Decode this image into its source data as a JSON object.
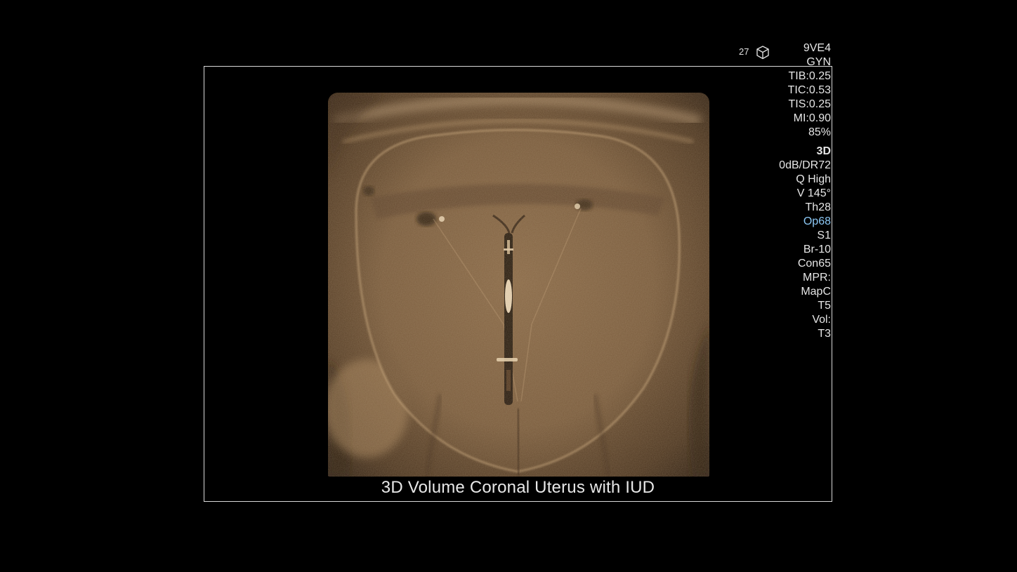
{
  "viewer": {
    "frame_counter": "27",
    "cube_icon": "3d-cube-icon",
    "caption": "3D Volume Coronal Uterus with IUD"
  },
  "params": {
    "probe": "9VE4",
    "preset": "GYN",
    "tib": "TIB:0.25",
    "tic": "TIC:0.53",
    "tis": "TIS:0.25",
    "mi": "MI:0.90",
    "power": "85%",
    "mode": "3D",
    "gain_dr": "0dB/DR72",
    "quality": "Q High",
    "volume_angle": "V 145°",
    "threshold": "Th28",
    "opacity": "Op68",
    "smoothing": "S1",
    "brightness": "Br-10",
    "contrast": "Con65",
    "mpr": "MPR:",
    "map": "MapC",
    "tint_1": "T5",
    "vol": "Vol:",
    "tint_2": "T3"
  },
  "colors": {
    "background": "#000000",
    "frame_border": "#d9d9d9",
    "accent_param": "#8cc8f5",
    "sepia_tone": "#8a6a45"
  }
}
